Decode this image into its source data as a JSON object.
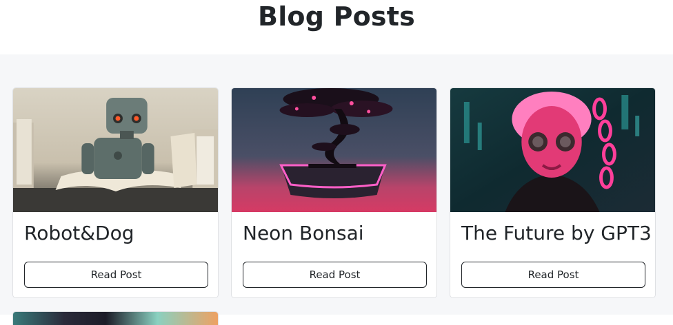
{
  "page": {
    "title": "Blog Posts"
  },
  "posts": [
    {
      "title": "Robot&Dog",
      "button_label": "Read Post",
      "image": "robot-reading-book-image"
    },
    {
      "title": "Neon Bonsai",
      "button_label": "Read Post",
      "image": "neon-bonsai-image"
    },
    {
      "title": "The Future by GPT3",
      "button_label": "Read Post",
      "image": "pink-cyber-mask-image"
    }
  ],
  "colors": {
    "page_background": "#f6f7f9",
    "card_border": "#dfe1e4",
    "text": "#212529",
    "neon_pink": "#ff3fa8"
  }
}
